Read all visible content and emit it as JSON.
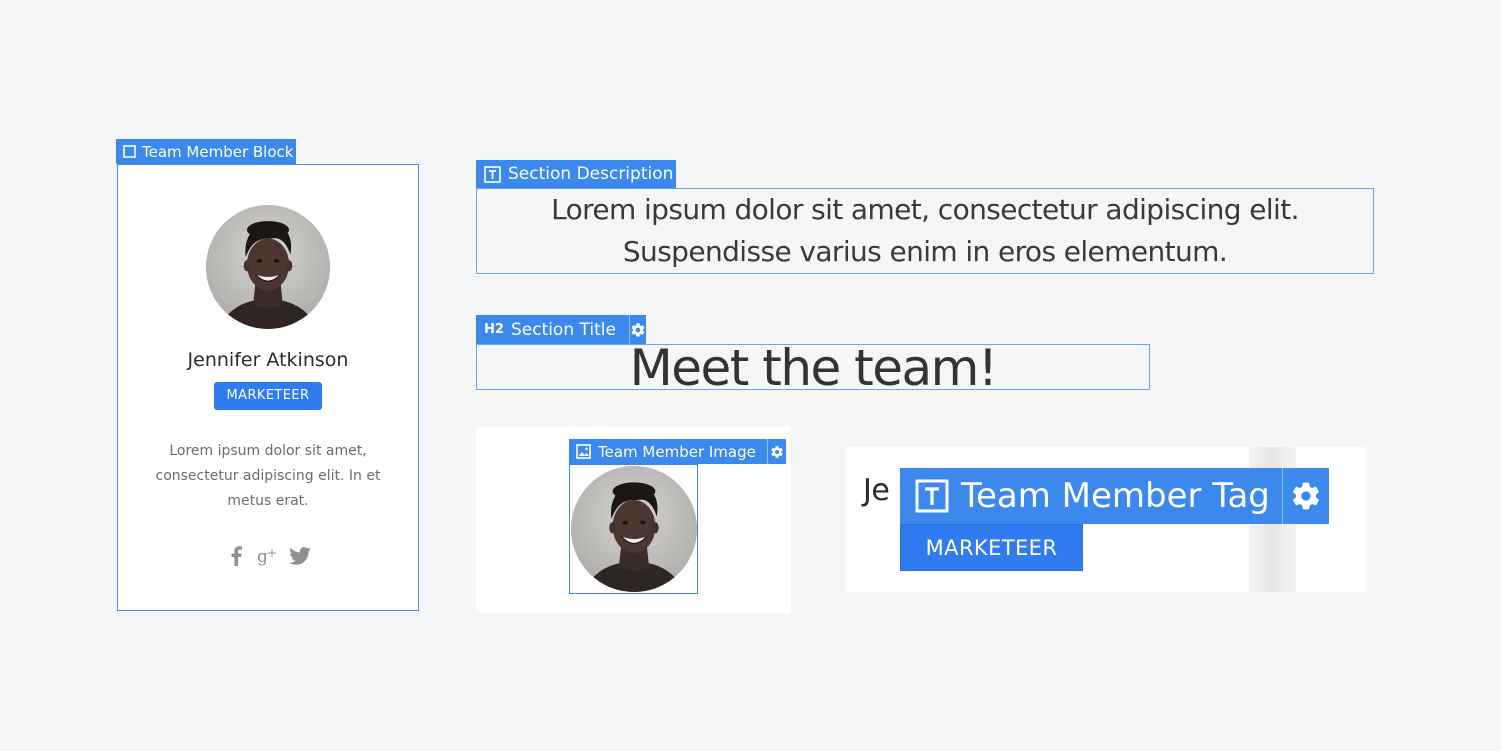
{
  "colors": {
    "page_background": "#f5f6f8",
    "selection_blue": "#3b89ec",
    "badge_blue": "#2f7bf0"
  },
  "card_block": {
    "tag_label": "Team Member Block",
    "tag_icon": "square-outline-icon",
    "name": "Jennifer Atkinson",
    "role_badge": "MARKETEER",
    "description": "Lorem ipsum dolor sit amet, consectetur adipiscing elit. In et metus erat.",
    "social_icons": [
      "facebook-icon",
      "google-plus-icon",
      "twitter-icon"
    ]
  },
  "section_description": {
    "tag_label": "Section Description",
    "tag_icon": "text-t-icon",
    "line1": "Lorem ipsum dolor sit amet, consectetur adipiscing elit.",
    "line2": "Suspendisse varius enim in eros elementum."
  },
  "section_title": {
    "tag_label": "Section Title",
    "tag_icon": "heading-h2-icon",
    "tag_icon_text": "H2",
    "text": "Meet the team!"
  },
  "team_member_image": {
    "tag_label": "Team Member Image",
    "tag_icon": "image-icon"
  },
  "team_member_tag": {
    "tag_label": "Team Member Tag",
    "tag_icon": "text-t-icon",
    "name_fragment": "Je",
    "badge": "MARKETEER"
  }
}
